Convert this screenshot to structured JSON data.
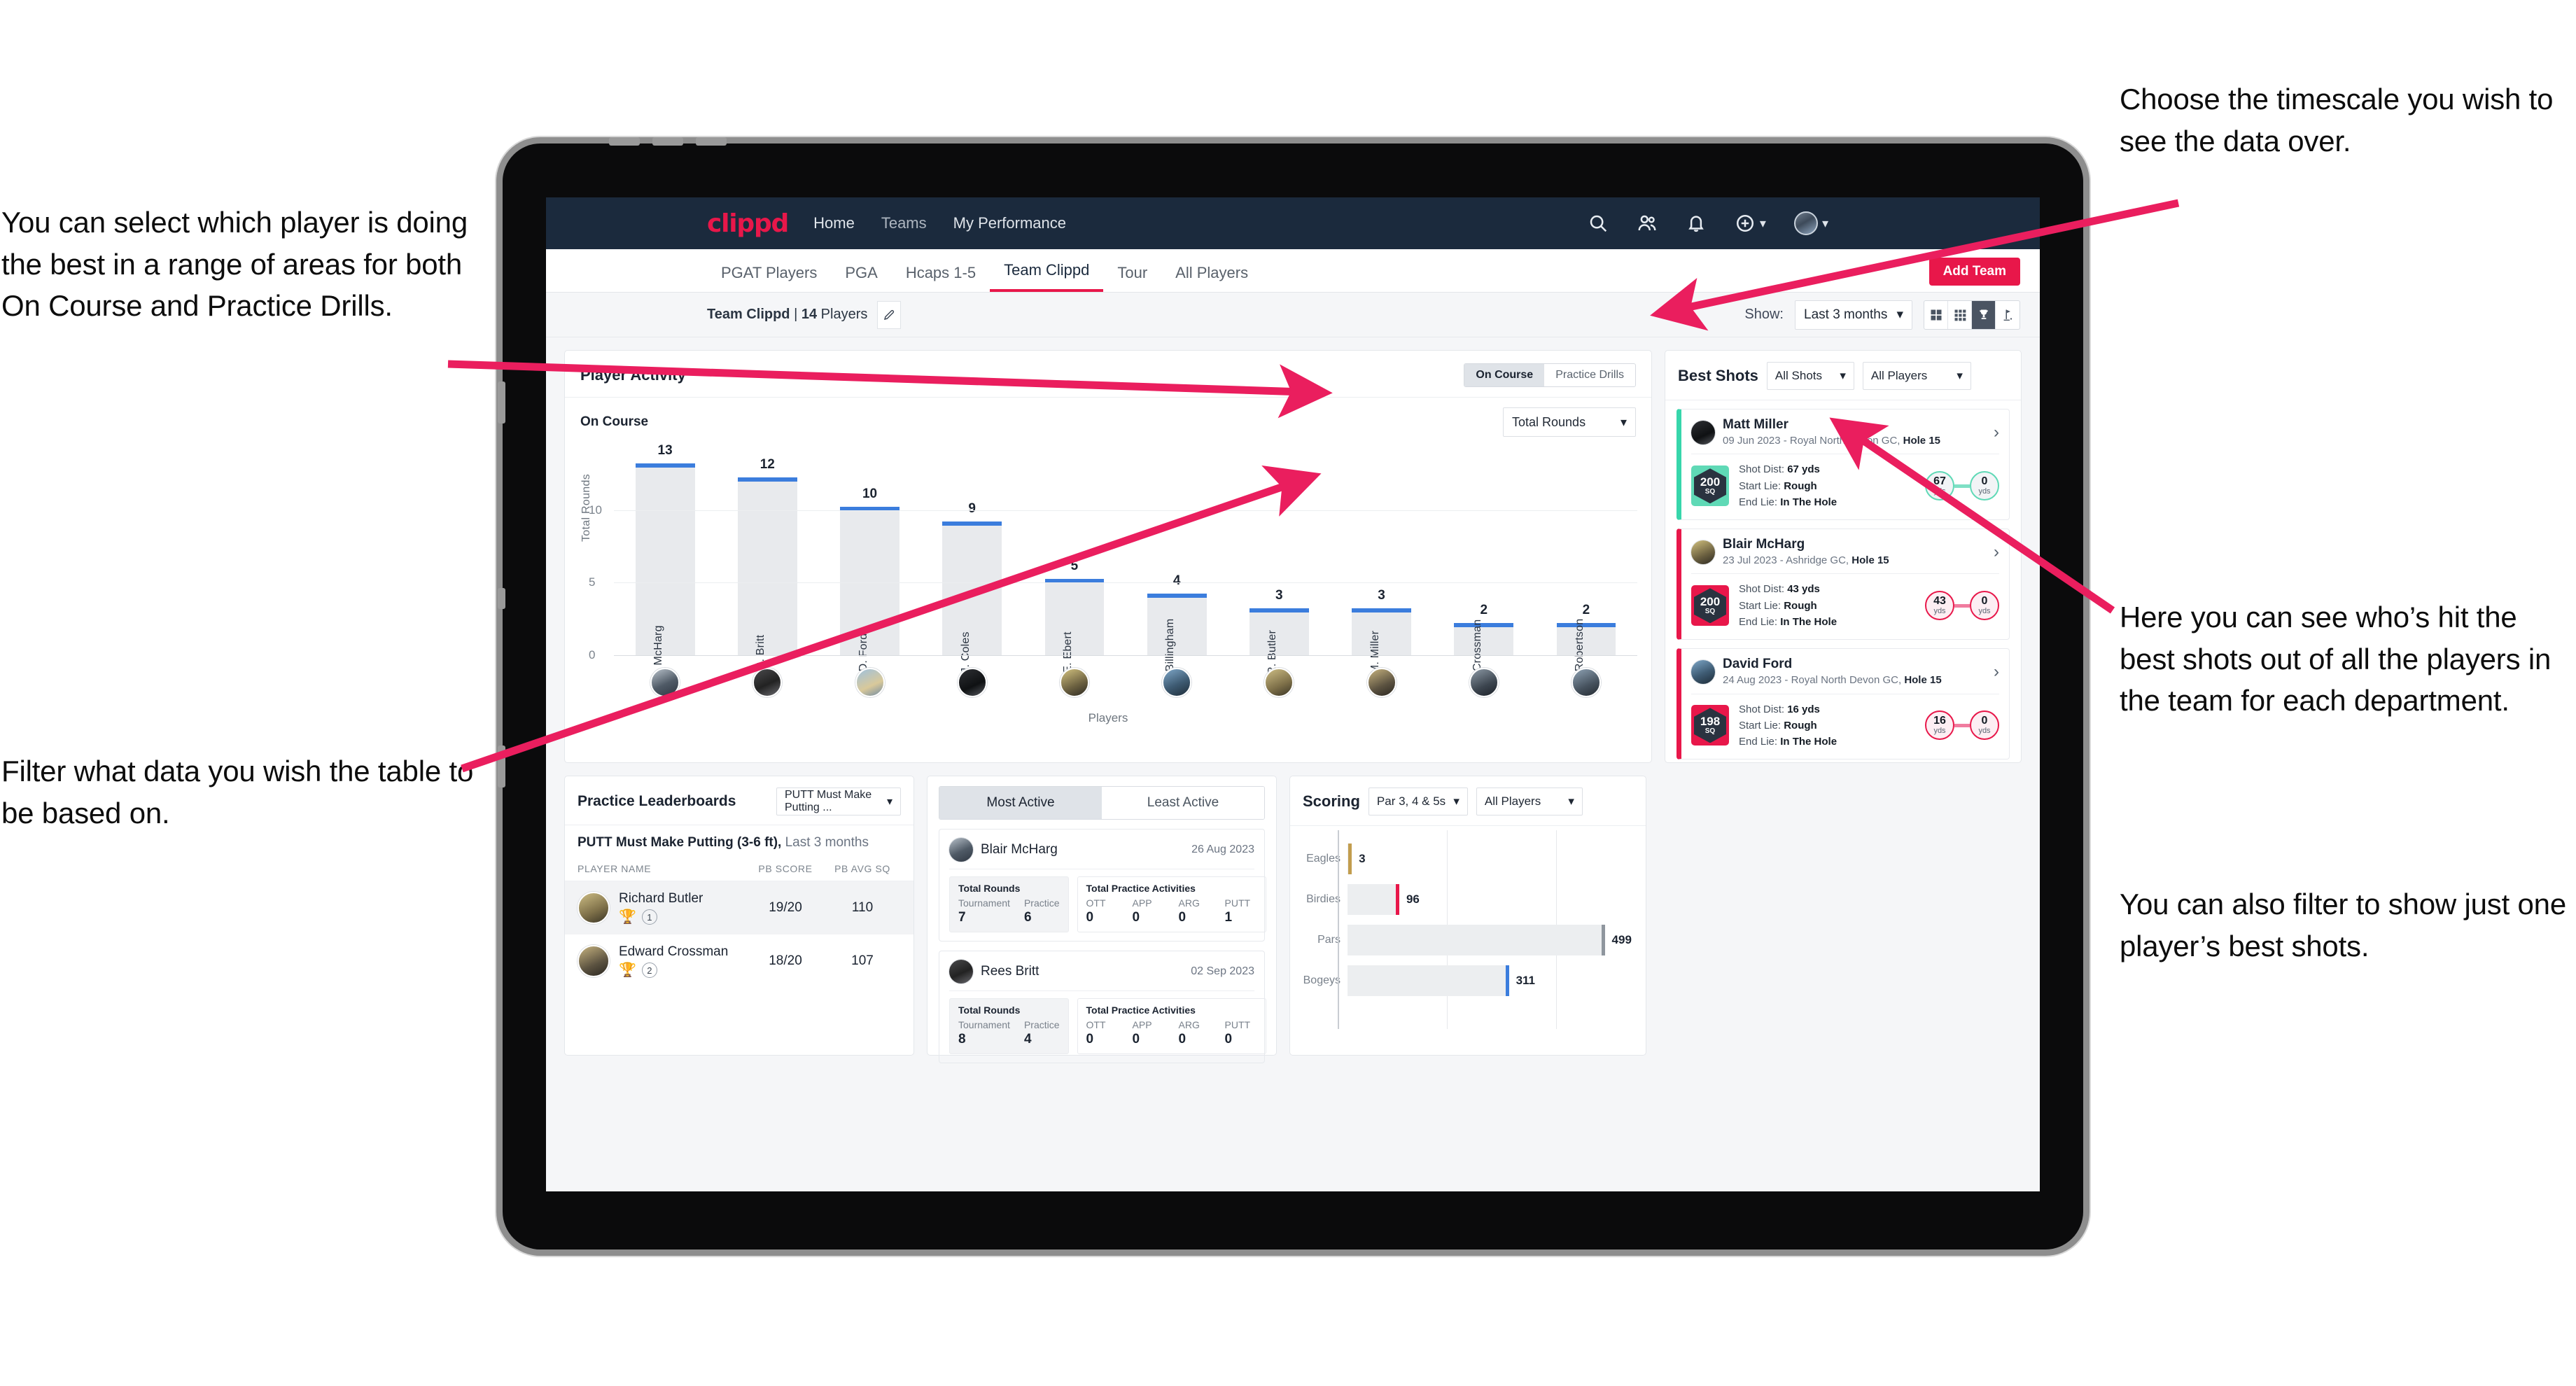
{
  "annotations": {
    "left_top": "You can select which player is doing the best in a range of areas for both On Course and Practice Drills.",
    "left_bottom": "Filter what data you wish the table to be based on.",
    "right_top": "Choose the timescale you wish to see the data over.",
    "right_middle": "Here you can see who’s hit the best shots out of all the players in the team for each department.",
    "right_bottom": "You can also filter to show just one player’s best shots."
  },
  "colors": {
    "brand_pink": "#e8174a",
    "nav_dark": "#1b2a3d",
    "bar_blue": "#3b7ddd",
    "teal": "#37d6ab",
    "eagle_gold": "#c29d4e"
  },
  "topnav": {
    "logo": "clippd",
    "links": [
      {
        "label": "Home",
        "active": true
      },
      {
        "label": "Teams",
        "active": false
      },
      {
        "label": "My Performance",
        "active": false
      }
    ],
    "icons": [
      "search-icon",
      "people-icon",
      "bell-icon",
      "plus-circle-icon",
      "avatar"
    ]
  },
  "tabs": [
    {
      "label": "PGAT Players",
      "active": false
    },
    {
      "label": "PGA",
      "active": false
    },
    {
      "label": "Hcaps 1-5",
      "active": false
    },
    {
      "label": "Team Clippd",
      "active": true
    },
    {
      "label": "Tour",
      "active": false
    },
    {
      "label": "All Players",
      "active": false
    }
  ],
  "subbar": {
    "team_name": "Team Clippd",
    "separator": "|",
    "player_count": "14",
    "players_word": "Players",
    "show_label": "Show:",
    "show_value": "Last 3 months",
    "add_team_label": "Add Team",
    "view_icons": [
      "grid-large-icon",
      "grid-small-icon",
      "trophy-icon",
      "golf-flag-icon"
    ],
    "active_view": "trophy-icon"
  },
  "player_activity": {
    "title": "Player Activity",
    "segments": [
      {
        "label": "On Course",
        "active": true
      },
      {
        "label": "Practice Drills",
        "active": false
      }
    ],
    "subtitle": "On Course",
    "metric_select": "Total Rounds"
  },
  "chart_data": {
    "type": "bar",
    "title": "Player Activity — On Course",
    "xlabel": "Players",
    "ylabel": "Total Rounds",
    "ylim": [
      0,
      14
    ],
    "yticks": [
      0,
      5,
      10
    ],
    "grid": true,
    "categories": [
      "B. McHarg",
      "R. Britt",
      "D. Ford",
      "J. Coles",
      "E. Ebert",
      "D. Billingham",
      "R. Butler",
      "M. Miller",
      "E. Crossman",
      "C. Robertson"
    ],
    "values": [
      13,
      12,
      10,
      9,
      5,
      4,
      3,
      3,
      2,
      2
    ]
  },
  "best_shots": {
    "title": "Best Shots",
    "shot_filter": "All Shots",
    "player_filter": "All Players",
    "items": [
      {
        "name": "Matt Miller",
        "meta_prefix": "09 Jun 2023 - Royal North Devon GC,",
        "hole": "Hole 15",
        "sq": "200",
        "sq_unit": "SQ",
        "accent": "teal",
        "shot_dist_label": "Shot Dist:",
        "shot_dist": "67 yds",
        "start_lie_label": "Start Lie:",
        "start_lie": "Rough",
        "end_lie_label": "End Lie:",
        "end_lie": "In The Hole",
        "from_value": "67",
        "from_unit": "yds",
        "to_value": "0",
        "to_unit": "yds"
      },
      {
        "name": "Blair McHarg",
        "meta_prefix": "23 Jul 2023 - Ashridge GC,",
        "hole": "Hole 15",
        "sq": "200",
        "sq_unit": "SQ",
        "accent": "pink",
        "shot_dist_label": "Shot Dist:",
        "shot_dist": "43 yds",
        "start_lie_label": "Start Lie:",
        "start_lie": "Rough",
        "end_lie_label": "End Lie:",
        "end_lie": "In The Hole",
        "from_value": "43",
        "from_unit": "yds",
        "to_value": "0",
        "to_unit": "yds"
      },
      {
        "name": "David Ford",
        "meta_prefix": "24 Aug 2023 - Royal North Devon GC,",
        "hole": "Hole 15",
        "sq": "198",
        "sq_unit": "SQ",
        "accent": "pink",
        "shot_dist_label": "Shot Dist:",
        "shot_dist": "16 yds",
        "start_lie_label": "Start Lie:",
        "start_lie": "Rough",
        "end_lie_label": "End Lie:",
        "end_lie": "In The Hole",
        "from_value": "16",
        "from_unit": "yds",
        "to_value": "0",
        "to_unit": "yds"
      }
    ]
  },
  "practice_leaderboards": {
    "title": "Practice Leaderboards",
    "drill_select": "PUTT Must Make Putting ...",
    "subtitle_bold": "PUTT Must Make Putting (3-6 ft),",
    "subtitle_grey": "Last 3 months",
    "columns": [
      "PLAYER NAME",
      "PB SCORE",
      "PB AVG SQ"
    ],
    "rows": [
      {
        "name": "Richard Butler",
        "rank": "1",
        "trophy": "gold",
        "pb_score": "19/20",
        "pb_avg_sq": "110"
      },
      {
        "name": "Edward Crossman",
        "rank": "2",
        "trophy": "silver",
        "pb_score": "18/20",
        "pb_avg_sq": "107"
      }
    ]
  },
  "activity": {
    "tabs": [
      {
        "label": "Most Active",
        "active": true
      },
      {
        "label": "Least Active",
        "active": false
      }
    ],
    "rounds_title": "Total Rounds",
    "rounds_keys": [
      "Tournament",
      "Practice"
    ],
    "practice_title": "Total Practice Activities",
    "practice_keys": [
      "OTT",
      "APP",
      "ARG",
      "PUTT"
    ],
    "items": [
      {
        "name": "Blair McHarg",
        "date": "26 Aug 2023",
        "rounds": [
          "7",
          "6"
        ],
        "practice": [
          "0",
          "0",
          "0",
          "1"
        ]
      },
      {
        "name": "Rees Britt",
        "date": "02 Sep 2023",
        "rounds": [
          "8",
          "4"
        ],
        "practice": [
          "0",
          "0",
          "0",
          "0"
        ]
      }
    ]
  },
  "scoring": {
    "title": "Scoring",
    "par_select": "Par 3, 4 & 5s",
    "player_select": "All Players",
    "chart": {
      "type": "bar",
      "orientation": "horizontal",
      "categories": [
        "Eagles",
        "Birdies",
        "Pars",
        "Bogeys"
      ],
      "values": [
        3,
        96,
        499,
        311
      ],
      "max": 560,
      "colors": [
        "#c29d4e",
        "#e8174a",
        "#8f969e",
        "#3b7ddd"
      ]
    }
  }
}
